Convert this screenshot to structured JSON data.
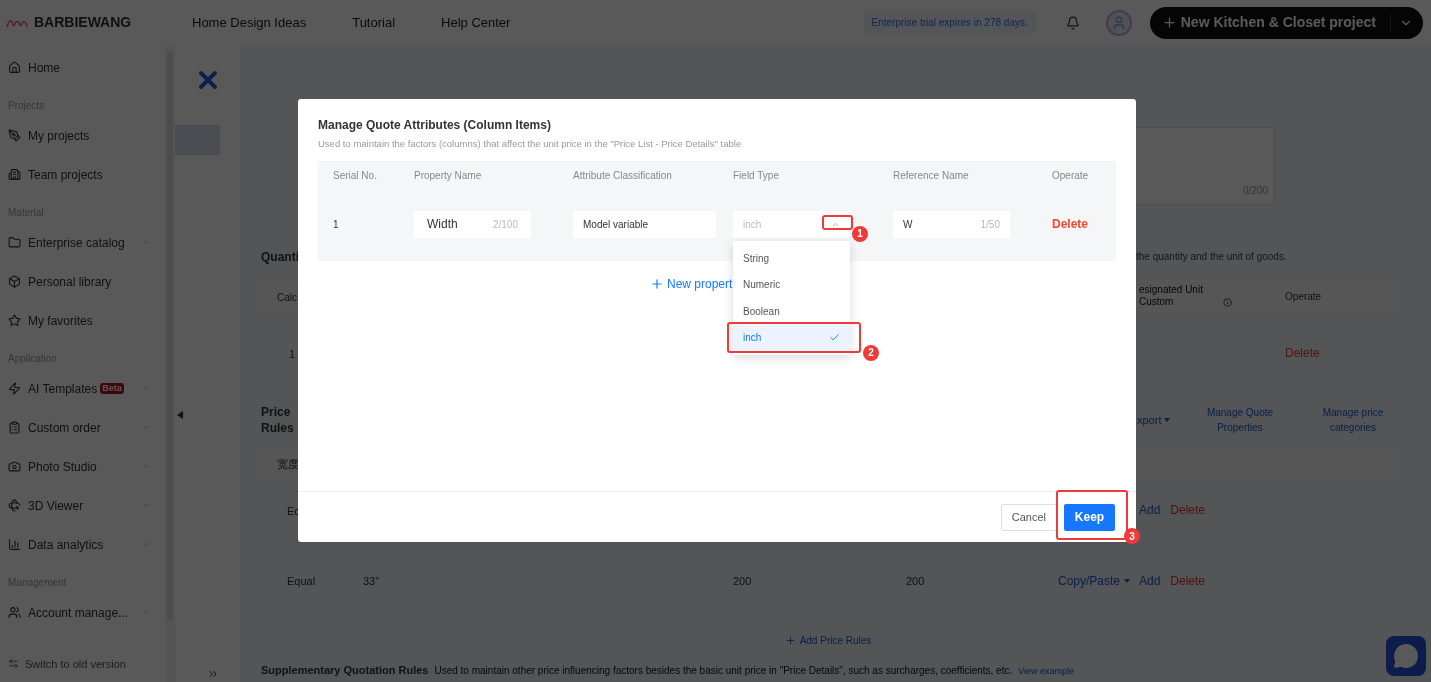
{
  "header": {
    "logo_text": "BARBIEWANG",
    "nav": [
      "Home Design Ideas",
      "Tutorial",
      "Help Center"
    ],
    "trial_notice": "Enterprise trial expires in 278 days.",
    "new_project_button": "New Kitchen & Closet project"
  },
  "sidebar": {
    "items": [
      {
        "kind": "item",
        "label": "Home",
        "expandable": false
      },
      {
        "kind": "section",
        "label": "Projects"
      },
      {
        "kind": "item",
        "label": "My projects",
        "expandable": false
      },
      {
        "kind": "item",
        "label": "Team projects",
        "expandable": false
      },
      {
        "kind": "section",
        "label": "Material"
      },
      {
        "kind": "item",
        "label": "Enterprise catalog",
        "expandable": true
      },
      {
        "kind": "item",
        "label": "Personal library",
        "expandable": false
      },
      {
        "kind": "item",
        "label": "My favorites",
        "expandable": false
      },
      {
        "kind": "section",
        "label": "Application"
      },
      {
        "kind": "item",
        "label": "AI Templates",
        "expandable": true,
        "badge": "Beta"
      },
      {
        "kind": "item",
        "label": "Custom order",
        "expandable": true
      },
      {
        "kind": "item",
        "label": "Photo Studio",
        "expandable": true
      },
      {
        "kind": "item",
        "label": "3D Viewer",
        "expandable": true
      },
      {
        "kind": "item",
        "label": "Data analytics",
        "expandable": true
      },
      {
        "kind": "section",
        "label": "Management"
      },
      {
        "kind": "item",
        "label": "Account manage...",
        "expandable": true
      }
    ],
    "switch_link": "Switch to old version"
  },
  "main": {
    "textarea_counter": "0/200",
    "quantity": {
      "title": "Quanti",
      "note": "the quantity and the unit of goods.",
      "columns": [
        "Calc",
        "esignated Unit Custom",
        "Operate"
      ],
      "row": {
        "serial": "1",
        "action": "Delete"
      }
    },
    "price_rules": {
      "title": "Price Rules",
      "actions": [
        "xport",
        "Manage Quote Properties",
        "Manage price categories"
      ],
      "column": "宽度",
      "rows": [
        {
          "cells": [
            "Ec"
          ],
          "actions": [
            "Add",
            "Delete"
          ]
        },
        {
          "cells": [
            "Equal",
            "33\"",
            "200",
            "200"
          ],
          "copy": "Copy/Paste",
          "actions": [
            "Add",
            "Delete"
          ]
        }
      ],
      "add_button": "Add Price Rules"
    },
    "supplementary": {
      "title": "Supplementary Quotation Rules",
      "description": "Used to maintain other price influencing factors besides the basic unit price in \"Price Details\", such as surcharges, coefficients, etc.",
      "link": "View example"
    }
  },
  "modal": {
    "title": "Manage Quote Attributes (Column Items)",
    "subtitle": "Used to maintain the factors (columns) that affect the unit price in the \"Price List - Price Details\" table",
    "columns": [
      "Serial No.",
      "Property Name",
      "Attribute Classification",
      "Field Type",
      "Reference Name",
      "Operate"
    ],
    "rows": [
      {
        "serial": "1",
        "property_name": "Width",
        "property_counter": "2/100",
        "classification": "Model variable",
        "field_type": "inch",
        "field_open": true,
        "reference_name": "W",
        "reference_counter": "1/50",
        "action": "Delete"
      }
    ],
    "new_property": "New propert",
    "options": [
      {
        "label": "String",
        "selected": false
      },
      {
        "label": "Numeric",
        "selected": false
      },
      {
        "label": "Boolean",
        "selected": false
      },
      {
        "label": "inch",
        "selected": true
      }
    ],
    "buttons": {
      "cancel": "Cancel",
      "keep": "Keep"
    },
    "annotations": [
      "1",
      "2",
      "3"
    ]
  }
}
